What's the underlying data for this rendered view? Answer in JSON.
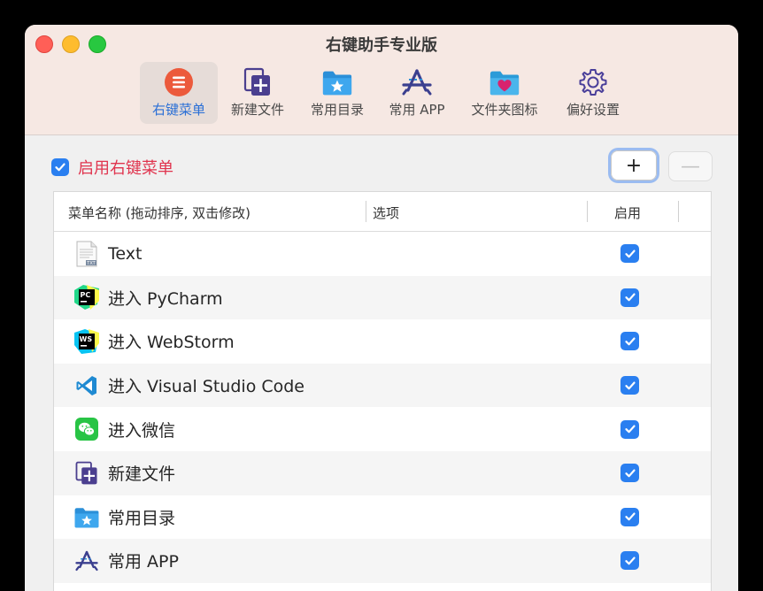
{
  "window": {
    "title": "右键助手专业版"
  },
  "toolbar": {
    "items": [
      {
        "label": "右键菜单",
        "icon": "menu-list-icon",
        "active": true
      },
      {
        "label": "新建文件",
        "icon": "new-file-icon",
        "active": false
      },
      {
        "label": "常用目录",
        "icon": "folder-star-icon",
        "active": false
      },
      {
        "label": "常用 APP",
        "icon": "app-store-icon",
        "active": false
      },
      {
        "label": "文件夹图标",
        "icon": "folder-heart-icon",
        "active": false
      },
      {
        "label": "偏好设置",
        "icon": "gear-icon",
        "active": false
      }
    ]
  },
  "content": {
    "enable_label": "启用右键菜单",
    "enabled": true,
    "add_label": "+",
    "remove_label": "—"
  },
  "table": {
    "columns": [
      "菜单名称 (拖动排序, 双击修改)",
      "选项",
      "启用"
    ],
    "rows": [
      {
        "icon": "text-file-icon",
        "label": "Text",
        "enabled": true
      },
      {
        "icon": "pycharm-icon",
        "label": "进入 PyCharm",
        "enabled": true
      },
      {
        "icon": "webstorm-icon",
        "label": "进入 WebStorm",
        "enabled": true
      },
      {
        "icon": "vscode-icon",
        "label": "进入 Visual Studio Code",
        "enabled": true
      },
      {
        "icon": "wechat-icon",
        "label": "进入微信",
        "enabled": true
      },
      {
        "icon": "new-file-icon",
        "label": "新建文件",
        "enabled": true
      },
      {
        "icon": "folder-star-icon",
        "label": "常用目录",
        "enabled": true
      },
      {
        "icon": "app-store-icon",
        "label": "常用 APP",
        "enabled": true
      }
    ]
  },
  "colors": {
    "accent": "#2a7ff0",
    "enable_label": "#e0344e",
    "titlebar": "#f6e8e3",
    "active_tab_text": "#2a6fd6"
  }
}
